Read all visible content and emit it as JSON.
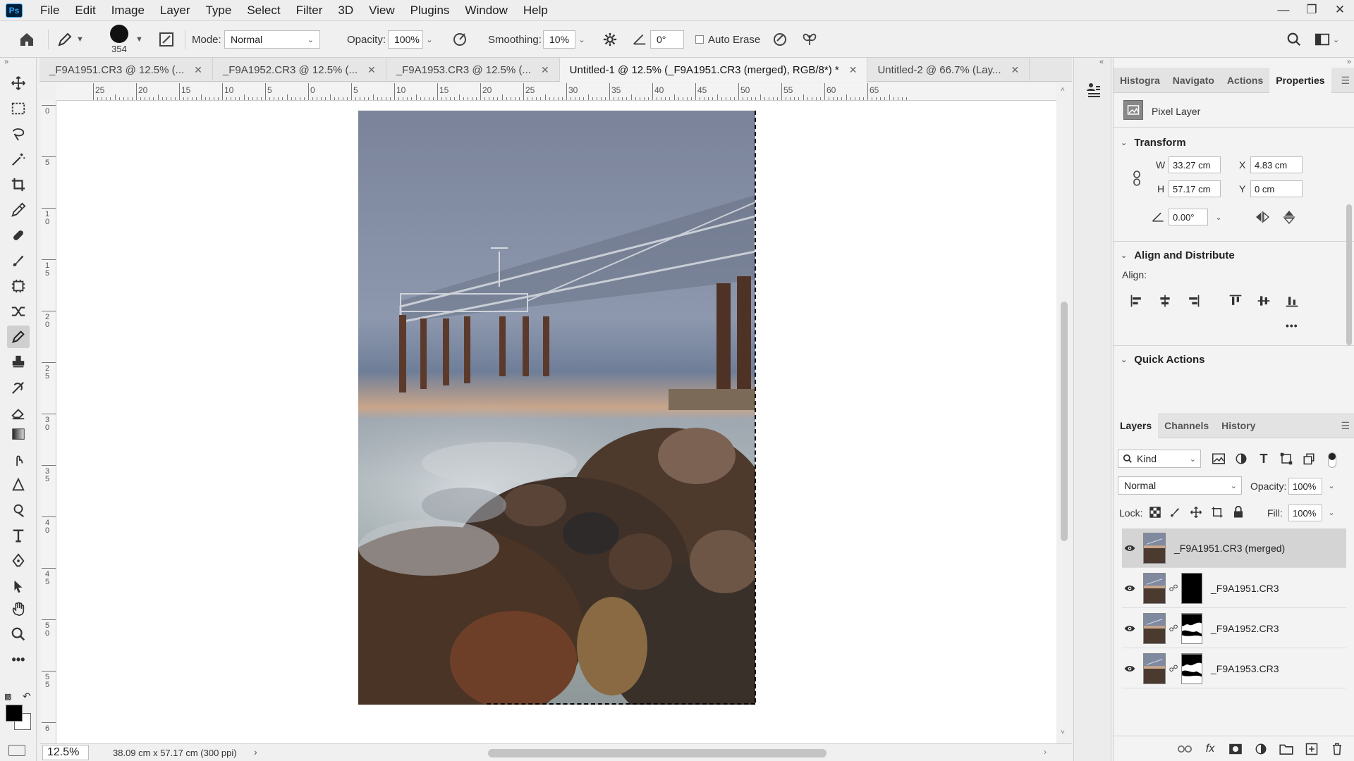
{
  "app": {
    "logo": "Ps"
  },
  "menu": [
    "File",
    "Edit",
    "Image",
    "Layer",
    "Type",
    "Select",
    "Filter",
    "3D",
    "View",
    "Plugins",
    "Window",
    "Help"
  ],
  "options": {
    "brush_size": "354",
    "mode_label": "Mode:",
    "mode_value": "Normal",
    "opacity_label": "Opacity:",
    "opacity_value": "100%",
    "smoothing_label": "Smoothing:",
    "smoothing_value": "10%",
    "angle_value": "0°",
    "auto_erase_label": "Auto Erase"
  },
  "tabs": [
    {
      "label": "_F9A1951.CR3 @ 12.5% (...",
      "active": false
    },
    {
      "label": "_F9A1952.CR3 @ 12.5% (...",
      "active": false
    },
    {
      "label": "_F9A1953.CR3 @ 12.5% (...",
      "active": false
    },
    {
      "label": "Untitled-1 @ 12.5% (_F9A1951.CR3 (merged), RGB/8*) *",
      "active": true
    },
    {
      "label": "Untitled-2 @ 66.7% (Lay...",
      "active": false
    }
  ],
  "ruler": {
    "h_labels": [
      "25",
      "20",
      "15",
      "10",
      "5",
      "0",
      "5",
      "10",
      "15",
      "20",
      "25",
      "30",
      "35",
      "40",
      "45",
      "50",
      "55",
      "60",
      "65"
    ],
    "v_labels": [
      "0",
      "5",
      "1 0",
      "1 5",
      "2 0",
      "2 5",
      "3 0",
      "3 5",
      "4 0",
      "4 5",
      "5 0",
      "5 5",
      "6"
    ]
  },
  "status": {
    "zoom": "12.5%",
    "doc_info": "38.09 cm x 57.17 cm (300 ppi)"
  },
  "properties": {
    "tabs": [
      "Histogra",
      "Navigato",
      "Actions",
      "Properties"
    ],
    "active_tab": "Properties",
    "layer_kind": "Pixel Layer",
    "transform_title": "Transform",
    "w_label": "W",
    "w_value": "33.27 cm",
    "h_label": "H",
    "h_value": "57.17 cm",
    "x_label": "X",
    "x_value": "4.83 cm",
    "y_label": "Y",
    "y_value": "0 cm",
    "angle_value": "0.00°",
    "align_title": "Align and Distribute",
    "align_label": "Align:",
    "more": "•••",
    "quick_actions_title": "Quick Actions"
  },
  "layers_panel": {
    "tabs": [
      "Layers",
      "Channels",
      "History"
    ],
    "active_tab": "Layers",
    "filter_kind": "Kind",
    "blend_mode": "Normal",
    "opacity_label": "Opacity:",
    "opacity_value": "100%",
    "lock_label": "Lock:",
    "fill_label": "Fill:",
    "fill_value": "100%",
    "layers": [
      {
        "name": "_F9A1951.CR3 (merged)",
        "selected": true,
        "mask": "none"
      },
      {
        "name": "_F9A1951.CR3",
        "selected": false,
        "mask": "black"
      },
      {
        "name": "_F9A1952.CR3",
        "selected": false,
        "mask": "pattern"
      },
      {
        "name": "_F9A1953.CR3",
        "selected": false,
        "mask": "pattern"
      }
    ]
  },
  "colors": {
    "accent_blue": "#31a8ff",
    "panel_bg": "#f3f3f3",
    "selected_layer": "#d4d4d4"
  }
}
